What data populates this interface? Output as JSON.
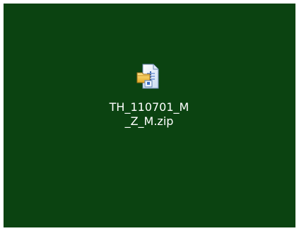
{
  "desktop": {
    "background_color": "#0b4311",
    "icons": [
      {
        "name": "TH_110701_M\n_Z_M.zip",
        "icon": "zip-archive-icon",
        "selected": false
      }
    ]
  }
}
